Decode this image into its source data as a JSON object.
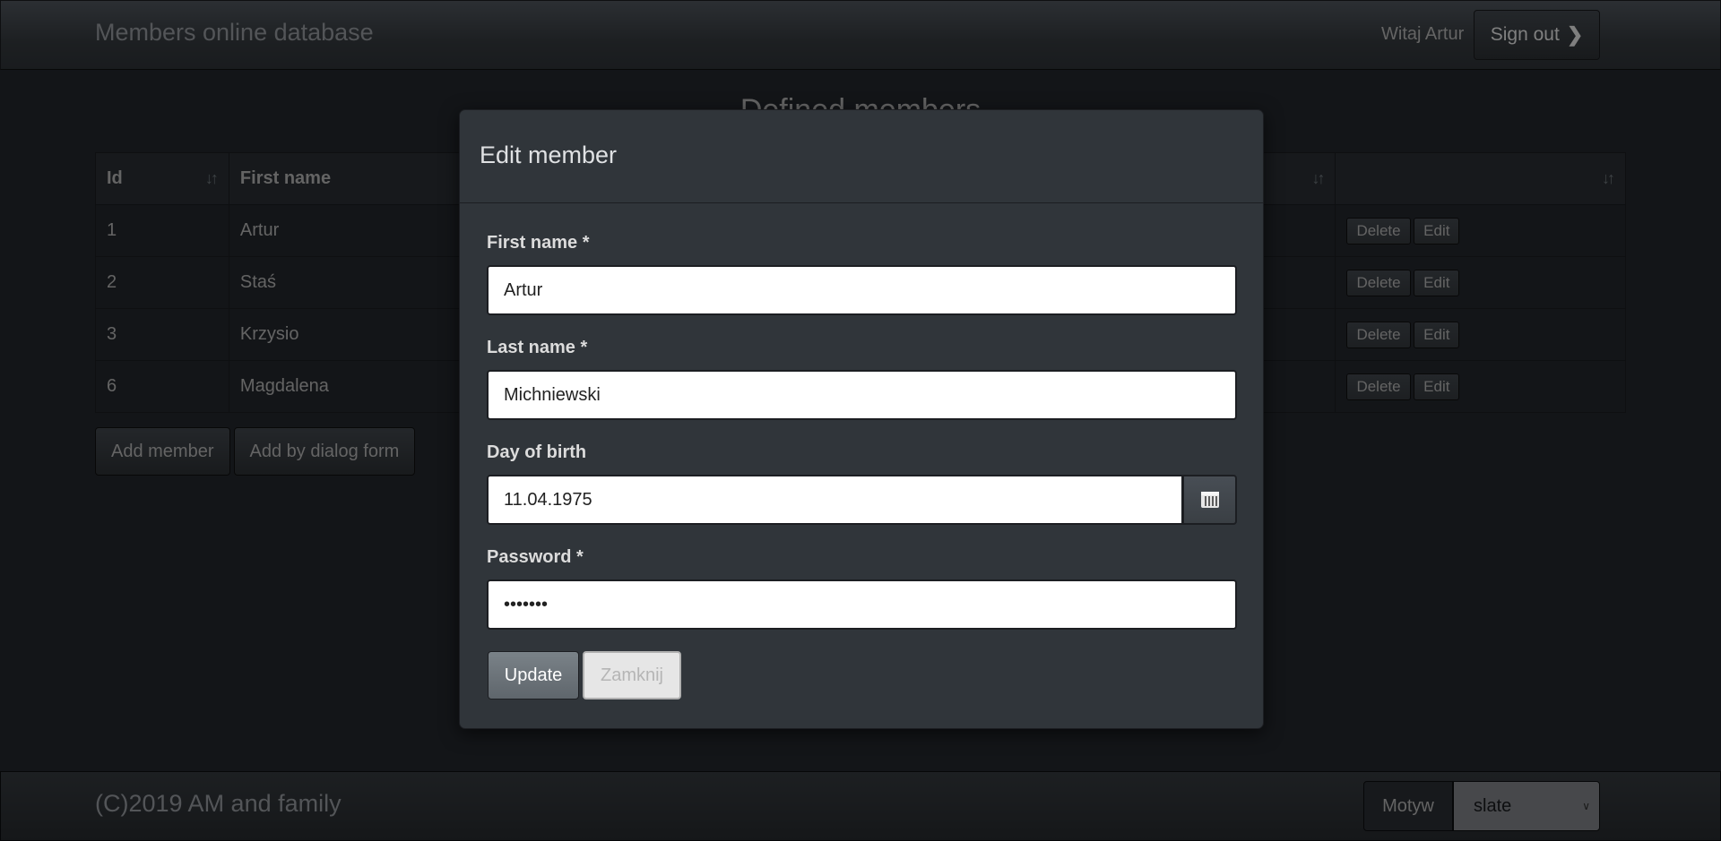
{
  "navbar": {
    "brand": "Members online database",
    "greeting": "Witaj Artur",
    "signout_label": "Sign out"
  },
  "main": {
    "title": "Defined members",
    "columns": [
      "Id",
      "First name",
      "",
      ""
    ],
    "rows": [
      {
        "id": "1",
        "first_name": "Artur"
      },
      {
        "id": "2",
        "first_name": "Staś"
      },
      {
        "id": "3",
        "first_name": "Krzysio"
      },
      {
        "id": "6",
        "first_name": "Magdalena"
      }
    ],
    "row_actions": {
      "delete": "Delete",
      "edit": "Edit"
    },
    "add_member_label": "Add member",
    "add_dialog_label": "Add by dialog form"
  },
  "modal": {
    "title": "Edit member",
    "first_name_label": "First name *",
    "first_name_value": "Artur",
    "last_name_label": "Last name *",
    "last_name_value": "Michniewski",
    "dob_label": "Day of birth",
    "dob_value": "11.04.1975",
    "password_label": "Password *",
    "password_value": "•••••••",
    "update_label": "Update",
    "close_label": "Zamknij"
  },
  "footer": {
    "copyright": "(C)2019 AM and family",
    "theme_label": "Motyw",
    "theme_value": "slate"
  },
  "icons": {
    "signout": "chevron-right-icon",
    "sort": "sort-icon",
    "calendar": "calendar-icon"
  }
}
